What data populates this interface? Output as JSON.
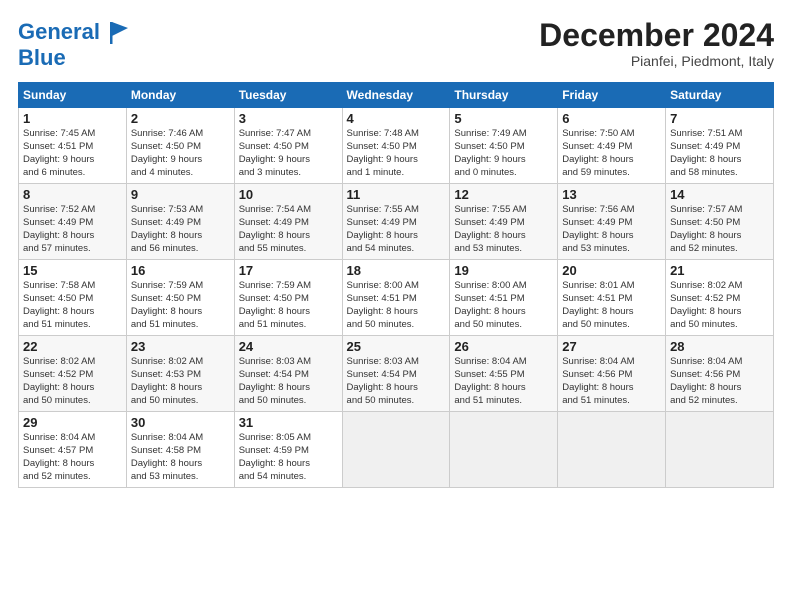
{
  "logo": {
    "line1": "General",
    "line2": "Blue"
  },
  "title": "December 2024",
  "subtitle": "Pianfei, Piedmont, Italy",
  "days_of_week": [
    "Sunday",
    "Monday",
    "Tuesday",
    "Wednesday",
    "Thursday",
    "Friday",
    "Saturday"
  ],
  "weeks": [
    [
      {
        "num": "1",
        "info": "Sunrise: 7:45 AM\nSunset: 4:51 PM\nDaylight: 9 hours\nand 6 minutes."
      },
      {
        "num": "2",
        "info": "Sunrise: 7:46 AM\nSunset: 4:50 PM\nDaylight: 9 hours\nand 4 minutes."
      },
      {
        "num": "3",
        "info": "Sunrise: 7:47 AM\nSunset: 4:50 PM\nDaylight: 9 hours\nand 3 minutes."
      },
      {
        "num": "4",
        "info": "Sunrise: 7:48 AM\nSunset: 4:50 PM\nDaylight: 9 hours\nand 1 minute."
      },
      {
        "num": "5",
        "info": "Sunrise: 7:49 AM\nSunset: 4:50 PM\nDaylight: 9 hours\nand 0 minutes."
      },
      {
        "num": "6",
        "info": "Sunrise: 7:50 AM\nSunset: 4:49 PM\nDaylight: 8 hours\nand 59 minutes."
      },
      {
        "num": "7",
        "info": "Sunrise: 7:51 AM\nSunset: 4:49 PM\nDaylight: 8 hours\nand 58 minutes."
      }
    ],
    [
      {
        "num": "8",
        "info": "Sunrise: 7:52 AM\nSunset: 4:49 PM\nDaylight: 8 hours\nand 57 minutes."
      },
      {
        "num": "9",
        "info": "Sunrise: 7:53 AM\nSunset: 4:49 PM\nDaylight: 8 hours\nand 56 minutes."
      },
      {
        "num": "10",
        "info": "Sunrise: 7:54 AM\nSunset: 4:49 PM\nDaylight: 8 hours\nand 55 minutes."
      },
      {
        "num": "11",
        "info": "Sunrise: 7:55 AM\nSunset: 4:49 PM\nDaylight: 8 hours\nand 54 minutes."
      },
      {
        "num": "12",
        "info": "Sunrise: 7:55 AM\nSunset: 4:49 PM\nDaylight: 8 hours\nand 53 minutes."
      },
      {
        "num": "13",
        "info": "Sunrise: 7:56 AM\nSunset: 4:49 PM\nDaylight: 8 hours\nand 53 minutes."
      },
      {
        "num": "14",
        "info": "Sunrise: 7:57 AM\nSunset: 4:50 PM\nDaylight: 8 hours\nand 52 minutes."
      }
    ],
    [
      {
        "num": "15",
        "info": "Sunrise: 7:58 AM\nSunset: 4:50 PM\nDaylight: 8 hours\nand 51 minutes."
      },
      {
        "num": "16",
        "info": "Sunrise: 7:59 AM\nSunset: 4:50 PM\nDaylight: 8 hours\nand 51 minutes."
      },
      {
        "num": "17",
        "info": "Sunrise: 7:59 AM\nSunset: 4:50 PM\nDaylight: 8 hours\nand 51 minutes."
      },
      {
        "num": "18",
        "info": "Sunrise: 8:00 AM\nSunset: 4:51 PM\nDaylight: 8 hours\nand 50 minutes."
      },
      {
        "num": "19",
        "info": "Sunrise: 8:00 AM\nSunset: 4:51 PM\nDaylight: 8 hours\nand 50 minutes."
      },
      {
        "num": "20",
        "info": "Sunrise: 8:01 AM\nSunset: 4:51 PM\nDaylight: 8 hours\nand 50 minutes."
      },
      {
        "num": "21",
        "info": "Sunrise: 8:02 AM\nSunset: 4:52 PM\nDaylight: 8 hours\nand 50 minutes."
      }
    ],
    [
      {
        "num": "22",
        "info": "Sunrise: 8:02 AM\nSunset: 4:52 PM\nDaylight: 8 hours\nand 50 minutes."
      },
      {
        "num": "23",
        "info": "Sunrise: 8:02 AM\nSunset: 4:53 PM\nDaylight: 8 hours\nand 50 minutes."
      },
      {
        "num": "24",
        "info": "Sunrise: 8:03 AM\nSunset: 4:54 PM\nDaylight: 8 hours\nand 50 minutes."
      },
      {
        "num": "25",
        "info": "Sunrise: 8:03 AM\nSunset: 4:54 PM\nDaylight: 8 hours\nand 50 minutes."
      },
      {
        "num": "26",
        "info": "Sunrise: 8:04 AM\nSunset: 4:55 PM\nDaylight: 8 hours\nand 51 minutes."
      },
      {
        "num": "27",
        "info": "Sunrise: 8:04 AM\nSunset: 4:56 PM\nDaylight: 8 hours\nand 51 minutes."
      },
      {
        "num": "28",
        "info": "Sunrise: 8:04 AM\nSunset: 4:56 PM\nDaylight: 8 hours\nand 52 minutes."
      }
    ],
    [
      {
        "num": "29",
        "info": "Sunrise: 8:04 AM\nSunset: 4:57 PM\nDaylight: 8 hours\nand 52 minutes."
      },
      {
        "num": "30",
        "info": "Sunrise: 8:04 AM\nSunset: 4:58 PM\nDaylight: 8 hours\nand 53 minutes."
      },
      {
        "num": "31",
        "info": "Sunrise: 8:05 AM\nSunset: 4:59 PM\nDaylight: 8 hours\nand 54 minutes."
      },
      {
        "num": "",
        "info": "",
        "empty": true
      },
      {
        "num": "",
        "info": "",
        "empty": true
      },
      {
        "num": "",
        "info": "",
        "empty": true
      },
      {
        "num": "",
        "info": "",
        "empty": true
      }
    ]
  ]
}
